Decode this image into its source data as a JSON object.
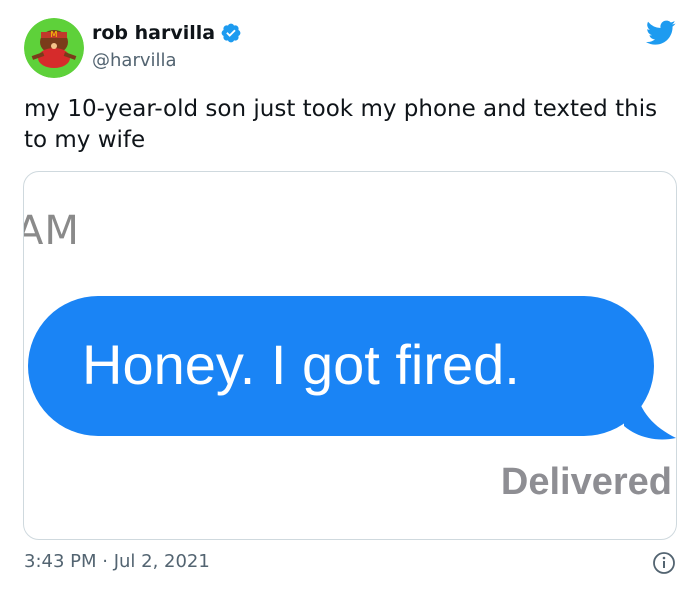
{
  "author": {
    "name": "rob harvilla",
    "handle": "@harvilla",
    "verified": true
  },
  "tweet": {
    "text": "my 10-year-old son just took my phone and texted this to my wife"
  },
  "media": {
    "am_label": "AM",
    "message": "Honey. I got fired.",
    "status": "Delivered"
  },
  "footer": {
    "timestamp": "3:43 PM · Jul 2, 2021"
  },
  "icons": {
    "verified": "verified-badge-icon",
    "twitter": "twitter-bird-icon",
    "info": "info-icon"
  },
  "colors": {
    "verified_blue": "#1d9bf0",
    "twitter_blue": "#1d9bf0",
    "bubble_blue": "#1a84f5",
    "handle_gray": "#536471",
    "avatar_bg": "#5ed13a"
  }
}
